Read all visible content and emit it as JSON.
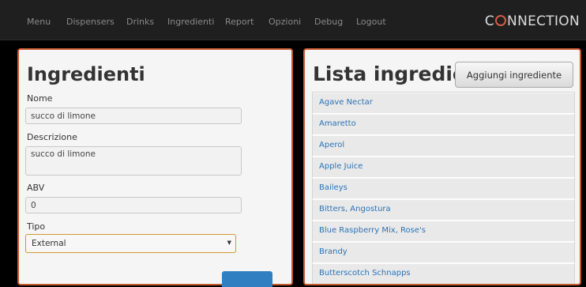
{
  "nav": {
    "items": [
      "Menu",
      "Dispensers",
      "Drinks",
      "Ingredienti",
      "Report",
      "Opzioni",
      "Debug",
      "Logout"
    ],
    "brand": {
      "prefix": "C",
      "suffix": "NNECTION"
    }
  },
  "form": {
    "title": "Ingredienti",
    "name_label": "Nome",
    "name_value": "succo di limone",
    "description_label": "Descrizione",
    "description_value": "succo di limone",
    "abv_label": "ABV",
    "abv_value": "0",
    "type_label": "Tipo",
    "type_value": "External"
  },
  "list": {
    "title": "Lista ingredienti",
    "add_label": "Aggiungi ingrediente",
    "items": [
      "Agave Nectar",
      "Amaretto",
      "Aperol",
      "Apple Juice",
      "Baileys",
      "Bitters, Angostura",
      "Blue Raspberry Mix, Rose's",
      "Brandy",
      "Butterscotch Schnapps"
    ]
  },
  "colors": {
    "panel_border": "#c65a2f",
    "link": "#2a73b6",
    "primary_button": "#2f7fc1",
    "brand_accent": "#d65a4a"
  }
}
